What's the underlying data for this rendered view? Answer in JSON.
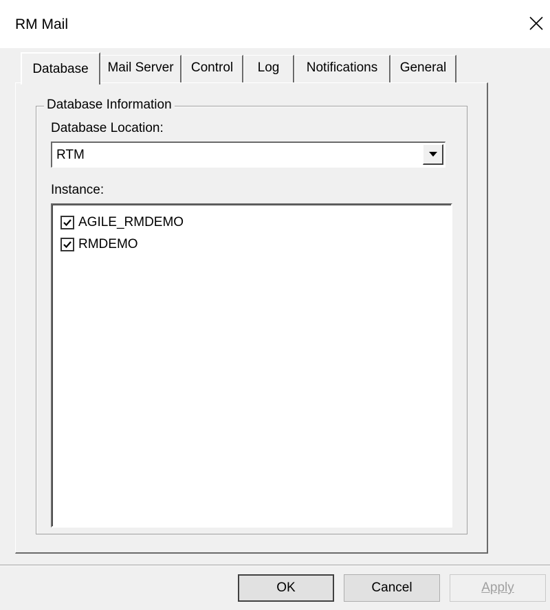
{
  "window": {
    "title": "RM Mail"
  },
  "tabs": [
    {
      "label": "Database",
      "active": true
    },
    {
      "label": "Mail Server",
      "active": false
    },
    {
      "label": "Control",
      "active": false
    },
    {
      "label": "Log",
      "active": false
    },
    {
      "label": "Notifications",
      "active": false
    },
    {
      "label": "General",
      "active": false
    }
  ],
  "database": {
    "group_title": "Database Information",
    "location_label": "Database Location:",
    "location_value": "RTM",
    "instances_label": "Instance:",
    "instances": [
      {
        "label": "AGILE_RMDEMO",
        "checked": true
      },
      {
        "label": "RMDEMO",
        "checked": true
      }
    ]
  },
  "buttons": {
    "ok": "OK",
    "cancel": "Cancel",
    "apply": "Apply"
  },
  "icons": {
    "close": "close-icon",
    "dropdown": "chevron-down-icon",
    "check": "checkmark-icon"
  },
  "colors": {
    "dialog_bg": "#f0f0f0",
    "titlebar_bg": "#ffffff",
    "disabled_text": "#a0a0a0"
  }
}
